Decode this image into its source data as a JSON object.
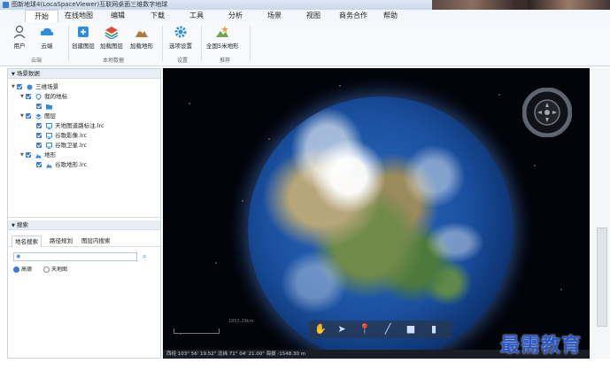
{
  "window": {
    "title": "图新地球4(LocaSpaceViewer)互联网桌面三维数字地球"
  },
  "menu": [
    "开始",
    "在线地图",
    "编辑",
    "下载",
    "工具",
    "分析",
    "场景",
    "视图",
    "商务合作",
    "帮助"
  ],
  "ribbon": {
    "groups": [
      {
        "label": "云端",
        "buttons": [
          "用户",
          "云端"
        ]
      },
      {
        "label": "本地数据",
        "buttons": [
          "创建图层",
          "加载图层",
          "加载地形"
        ]
      },
      {
        "label": "设置",
        "buttons": [
          "选项设置"
        ]
      },
      {
        "label": "推荐",
        "buttons": [
          "全国5米地形"
        ]
      }
    ]
  },
  "scene_panel": {
    "title": "场景数据",
    "tree": [
      {
        "label": "三维场景",
        "icon": "globe-icon"
      },
      {
        "label": "我的地标",
        "icon": "pin-icon"
      },
      {
        "label": "",
        "icon": "folder-icon"
      },
      {
        "label": "图层",
        "icon": "layers-icon"
      },
      {
        "label": "天地图道路标注.lrc",
        "icon": "monitor-icon"
      },
      {
        "label": "谷歌影像.lrc",
        "icon": "monitor-icon"
      },
      {
        "label": "谷歌卫星.lrc",
        "icon": "monitor-icon"
      },
      {
        "label": "地形",
        "icon": "terrain-icon"
      },
      {
        "label": "谷歌地形.lrc",
        "icon": "terrain-icon"
      }
    ]
  },
  "search_panel": {
    "title": "搜索",
    "tabs": [
      "地名搜索",
      "路径规划",
      "图层内搜索"
    ],
    "input_value": "",
    "options": [
      "高德",
      "天地图"
    ],
    "selected_option": "高德"
  },
  "viewport": {
    "scale_label": "1853.29km",
    "status_text": "西经 103° 56' 19.52\" 北纬 71° 04' 21.00\"  海拔 -1548.30 m",
    "toolbar_icons": [
      "hand-icon",
      "cursor-icon",
      "pin-icon",
      "line-icon",
      "square-icon",
      "chart-icon"
    ]
  },
  "watermark": "最需教育",
  "colors": {
    "accent": "#3b79d6",
    "viewport_bg": "#02040a",
    "ocean": "#1a4f9e"
  }
}
